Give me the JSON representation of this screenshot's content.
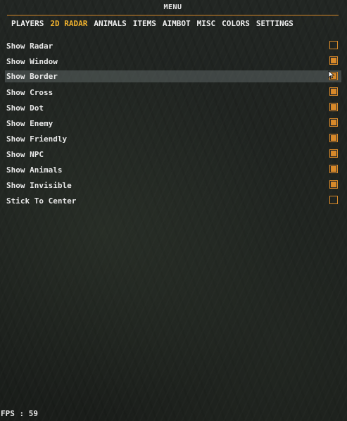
{
  "window": {
    "title": "MENU",
    "accent_color": "#d7892a",
    "active_tab_color": "#f2b32e"
  },
  "tabs": [
    {
      "label": "PLAYERS",
      "active": false
    },
    {
      "label": "2D RADAR",
      "active": true
    },
    {
      "label": "ANIMALS",
      "active": false
    },
    {
      "label": "ITEMS",
      "active": false
    },
    {
      "label": "AIMBOT",
      "active": false
    },
    {
      "label": "MISC",
      "active": false
    },
    {
      "label": "COLORS",
      "active": false
    },
    {
      "label": "SETTINGS",
      "active": false
    }
  ],
  "options": [
    {
      "label": "Show Radar",
      "checked": false,
      "hovered": false
    },
    {
      "label": "Show Window",
      "checked": true,
      "hovered": false
    },
    {
      "label": "Show Border",
      "checked": true,
      "hovered": true
    },
    {
      "label": "Show Cross",
      "checked": true,
      "hovered": false
    },
    {
      "label": "Show Dot",
      "checked": true,
      "hovered": false
    },
    {
      "label": "Show Enemy",
      "checked": true,
      "hovered": false
    },
    {
      "label": "Show Friendly",
      "checked": true,
      "hovered": false
    },
    {
      "label": "Show NPC",
      "checked": true,
      "hovered": false
    },
    {
      "label": "Show Animals",
      "checked": true,
      "hovered": false
    },
    {
      "label": "Show Invisible",
      "checked": true,
      "hovered": false
    },
    {
      "label": "Stick To Center",
      "checked": false,
      "hovered": false
    }
  ],
  "status": {
    "fps_text": "FPS : 59"
  },
  "icons": {
    "cursor": "mouse-pointer-icon"
  }
}
